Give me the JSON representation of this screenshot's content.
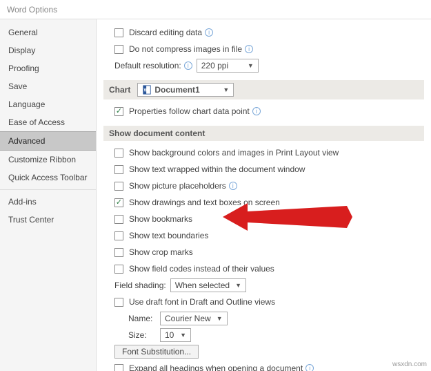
{
  "window": {
    "title": "Word Options"
  },
  "sidebar": {
    "items": [
      {
        "label": "General"
      },
      {
        "label": "Display"
      },
      {
        "label": "Proofing"
      },
      {
        "label": "Save"
      },
      {
        "label": "Language"
      },
      {
        "label": "Ease of Access"
      },
      {
        "label": "Advanced",
        "selected": true
      },
      {
        "label": "Customize Ribbon"
      },
      {
        "label": "Quick Access Toolbar"
      },
      {
        "label": "Add-ins"
      },
      {
        "label": "Trust Center"
      }
    ]
  },
  "top": {
    "discard_label": "Discard editing data",
    "compress_label": "Do not compress images in file",
    "default_res_label": "Default resolution:",
    "default_res_value": "220 ppi"
  },
  "chart": {
    "header": "Chart",
    "doc_value": "Document1",
    "follow_label": "Properties follow chart data point"
  },
  "doc_content": {
    "header": "Show document content",
    "bg_label": "Show background colors and images in Print Layout view",
    "wrap_label": "Show text wrapped within the document window",
    "pic_label": "Show picture placeholders",
    "draw_label": "Show drawings and text boxes on screen",
    "bookmarks_label": "Show bookmarks",
    "textbound_label": "Show text boundaries",
    "crop_label": "Show crop marks",
    "fieldcodes_label": "Show field codes instead of their values",
    "field_shading_label": "Field shading:",
    "field_shading_value": "When selected",
    "draft_label": "Use draft font in Draft and Outline views",
    "name_label": "Name:",
    "name_value": "Courier New",
    "size_label": "Size:",
    "size_value": "10",
    "font_sub_btn": "Font Substitution...",
    "expand_label": "Expand all headings when opening a document"
  },
  "watermark": "wsxdn.com"
}
